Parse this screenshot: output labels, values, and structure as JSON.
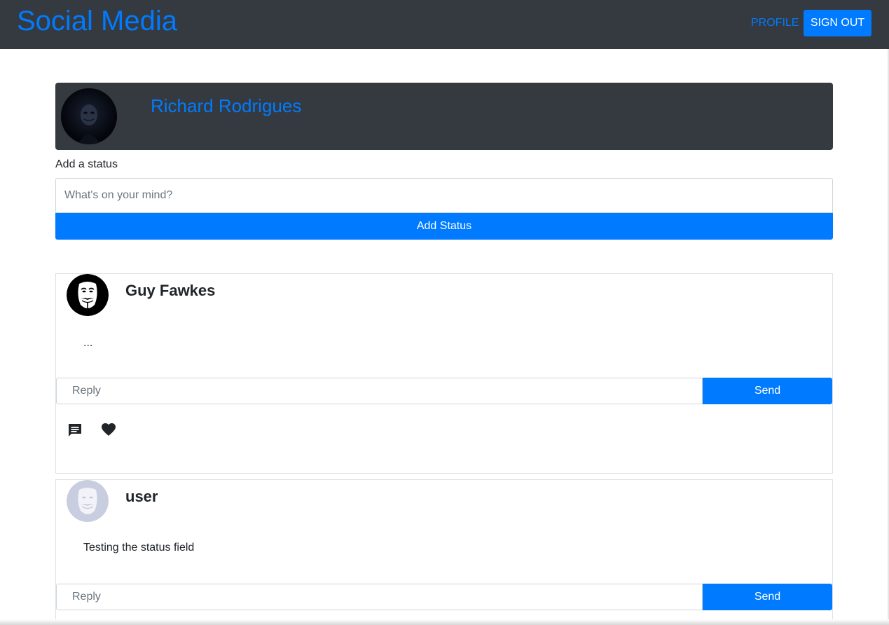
{
  "navbar": {
    "brand": "Social Media",
    "profile_link": "PROFILE",
    "signout_button": "SIGN OUT"
  },
  "profile": {
    "name": "Richard Rodrigues",
    "avatar_icon": "dark-hooded-mask-avatar"
  },
  "composer": {
    "label": "Add a status",
    "placeholder": "What's on your mind?",
    "submit_label": "Add Status"
  },
  "posts": [
    {
      "author": "Guy Fawkes",
      "text": "...",
      "avatar_icon": "guy-fawkes-mask-avatar",
      "reply_placeholder": "Reply",
      "send_label": "Send",
      "actions": [
        "comment-icon",
        "heart-icon"
      ]
    },
    {
      "author": "user",
      "text": "Testing the status field",
      "avatar_icon": "faded-mask-avatar",
      "reply_placeholder": "Reply",
      "send_label": "Send"
    }
  ],
  "colors": {
    "navbar_bg": "#343a40",
    "accent": "#007bff",
    "text": "#212529"
  }
}
